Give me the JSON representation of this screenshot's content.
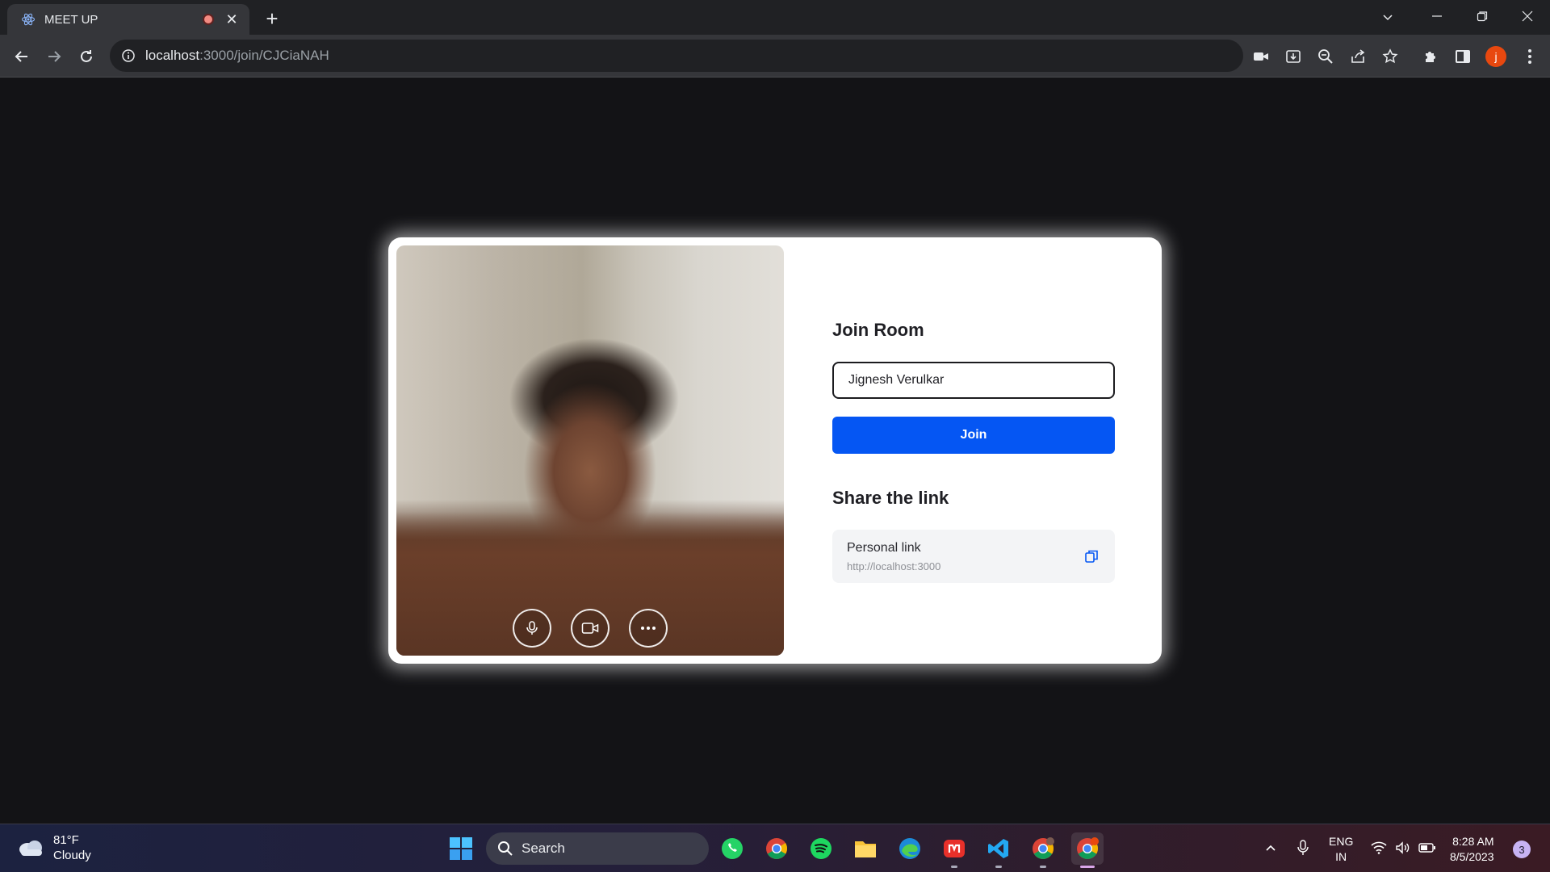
{
  "browser": {
    "tab": {
      "title": "MEET UP",
      "favicon": "react-icon",
      "recording": true
    },
    "url": {
      "host": "localhost",
      "path": ":3000/join/CJCiaNAH"
    },
    "profile_initial": "j"
  },
  "page": {
    "join_heading": "Join Room",
    "name_input": {
      "value": "Jignesh Verulkar",
      "placeholder": ""
    },
    "join_button": "Join",
    "share_heading": "Share the link",
    "personal_link": {
      "label": "Personal link",
      "url": "http://localhost:3000"
    },
    "video_controls": [
      "microphone-icon",
      "camera-icon",
      "more-icon"
    ]
  },
  "taskbar": {
    "weather": {
      "temperature": "81°F",
      "condition": "Cloudy"
    },
    "search_label": "Search",
    "apps": [
      "whatsapp",
      "chrome",
      "spotify",
      "file-explorer",
      "edge",
      "anydesk",
      "vscode",
      "chrome-profile",
      "chrome-active"
    ],
    "language": {
      "line1": "ENG",
      "line2": "IN"
    },
    "clock": {
      "time": "8:28 AM",
      "date": "8/5/2023"
    },
    "notification_count": "3"
  },
  "colors": {
    "accent": "#0556f3",
    "background": "#131316",
    "card": "#ffffff",
    "profile": "#e8480f"
  }
}
